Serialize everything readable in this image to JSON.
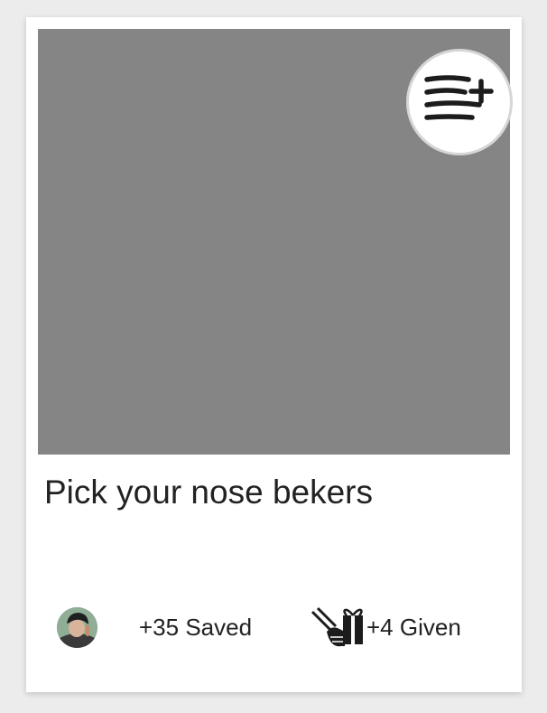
{
  "card": {
    "title": "Pick your nose bekers",
    "media_color": "#858585",
    "add_to_list_icon": "playlist-add-icon",
    "author_avatar_icon": "avatar-portrait",
    "saved_label": "+35 Saved",
    "given_icon": "hand-giving-gift-icon",
    "given_label": "+4 Given"
  },
  "colors": {
    "background": "#ececec",
    "card": "#ffffff",
    "text": "#222222"
  }
}
